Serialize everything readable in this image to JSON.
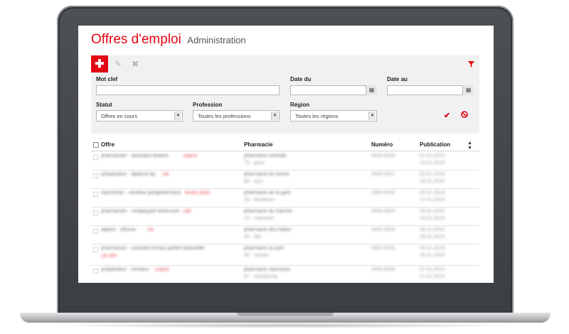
{
  "page": {
    "title": "Offres d'emploi",
    "subtitle": "Administration"
  },
  "toolbar": {
    "icons": [
      "plus-icon",
      "pencil-icon",
      "close-icon",
      "filter-icon"
    ],
    "accent_color": "#e30613"
  },
  "filters": {
    "keyword_label": "Mot clef",
    "keyword_value": "",
    "date_from_label": "Date du",
    "date_from_value": "",
    "date_to_label": "Date au",
    "date_to_value": "",
    "status_label": "Statut",
    "status_value": "Offres en cours",
    "profession_label": "Profession",
    "profession_value": "Toutes les professions",
    "region_label": "Région",
    "region_value": "Toutes les régions"
  },
  "table": {
    "columns": {
      "offer": "Offre",
      "pharmacy": "Pharmacie",
      "number": "Numéro",
      "publication": "Publication"
    },
    "rows": [
      {
        "offer_a": "pharmacien · assistant titulaire",
        "offer_b": "urgent",
        "offer_c": "",
        "pharmacy_1": "pharmacie centrale",
        "pharmacy_2": "75 · paris",
        "number": "0000-0000",
        "pub_1": "01.01.2019",
        "pub_2": "15.01.2019"
      },
      {
        "offer_a": "préparateur · diplômé bp",
        "offer_b": "cdi",
        "offer_c": "",
        "pharmacy_1": "pharmacie du centre",
        "pharmacy_2": "69 · lyon",
        "number": "0000-0001",
        "pub_1": "02.01.2019",
        "pub_2": "16.01.2019"
      },
      {
        "offer_a": "rayonniste · vendeur parapharmacie",
        "offer_b": "temps plein",
        "offer_c": "",
        "pharmacy_1": "pharmacie de la gare",
        "pharmacy_2": "33 · bordeaux",
        "number": "0000-0002",
        "pub_1": "03.01.2019",
        "pub_2": "17.01.2019"
      },
      {
        "offer_a": "pharmacien · remplaçant week-end",
        "offer_b": "cdd",
        "offer_c": "",
        "pharmacy_1": "pharmacie du marché",
        "pharmacy_2": "13 · marseille",
        "number": "0000-0003",
        "pub_1": "04.01.2019",
        "pub_2": "18.01.2019"
      },
      {
        "offer_a": "adjoint · officine",
        "offer_b": "cdi",
        "offer_c": "",
        "pharmacy_1": "pharmacie des halles",
        "pharmacy_2": "59 · lille",
        "number": "0000-0004",
        "pub_1": "05.01.2019",
        "pub_2": "19.01.2019"
      },
      {
        "offer_a": "pharmacien · assistant temps partiel disponible",
        "offer_b": "",
        "offer_c": "cdi 35h",
        "pharmacy_1": "pharmacie du port",
        "pharmacy_2": "44 · nantes",
        "number": "0000-0005",
        "pub_1": "06.01.2019",
        "pub_2": "20.01.2019"
      },
      {
        "offer_a": "préparateur · vendeur",
        "offer_b": "urgent",
        "offer_c": "",
        "pharmacy_1": "pharmacie saint-jean",
        "pharmacy_2": "67 · strasbourg",
        "number": "0000-0006",
        "pub_1": "07.01.2019",
        "pub_2": "21.01.2019"
      }
    ]
  }
}
